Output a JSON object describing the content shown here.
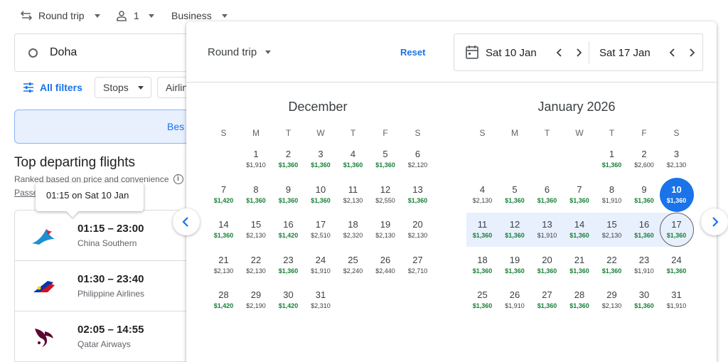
{
  "topbar": {
    "trip": "Round trip",
    "passengers": "1",
    "cabin": "Business"
  },
  "search": {
    "origin": "Doha"
  },
  "filters": {
    "all": "All filters",
    "stops": "Stops",
    "airlines": "Airlin"
  },
  "tabs": {
    "best": "Bes"
  },
  "results": {
    "heading": "Top departing flights",
    "subtitle": "Ranked based on price and convenience",
    "passenger_link": "Passe",
    "tooltip": "01:15 on Sat 10 Jan",
    "flights": [
      {
        "time": "01:15 – 23:00",
        "airline": "China Southern",
        "logo": "china-southern-logo"
      },
      {
        "time": "01:30 – 23:40",
        "airline": "Philippine Airlines",
        "logo": "philippine-airlines-logo"
      },
      {
        "time": "02:05 – 14:55",
        "airline": "Qatar Airways",
        "logo": "qatar-airways-logo"
      }
    ]
  },
  "picker": {
    "trip": "Round trip",
    "reset": "Reset",
    "depart": "Sat 10 Jan",
    "return": "Sat 17 Jan",
    "weekdays": [
      "S",
      "M",
      "T",
      "W",
      "T",
      "F",
      "S"
    ],
    "months": [
      {
        "title": "December",
        "offset": 1,
        "days": [
          {
            "d": "1",
            "p": "$1,910",
            "g": false
          },
          {
            "d": "2",
            "p": "$1,360",
            "g": true
          },
          {
            "d": "3",
            "p": "$1,360",
            "g": true
          },
          {
            "d": "4",
            "p": "$1,360",
            "g": true
          },
          {
            "d": "5",
            "p": "$1,360",
            "g": true
          },
          {
            "d": "6",
            "p": "$2,120",
            "g": false
          },
          {
            "d": "7",
            "p": "$1,420",
            "g": true
          },
          {
            "d": "8",
            "p": "$1,360",
            "g": true
          },
          {
            "d": "9",
            "p": "$1,360",
            "g": true
          },
          {
            "d": "10",
            "p": "$1,360",
            "g": true
          },
          {
            "d": "11",
            "p": "$2,130",
            "g": false
          },
          {
            "d": "12",
            "p": "$2,550",
            "g": false
          },
          {
            "d": "13",
            "p": "$1,360",
            "g": true
          },
          {
            "d": "14",
            "p": "$1,360",
            "g": true
          },
          {
            "d": "15",
            "p": "$2,130",
            "g": false
          },
          {
            "d": "16",
            "p": "$1,420",
            "g": true
          },
          {
            "d": "17",
            "p": "$2,510",
            "g": false
          },
          {
            "d": "18",
            "p": "$2,320",
            "g": false
          },
          {
            "d": "19",
            "p": "$2,130",
            "g": false
          },
          {
            "d": "20",
            "p": "$2,130",
            "g": false
          },
          {
            "d": "21",
            "p": "$2,130",
            "g": false
          },
          {
            "d": "22",
            "p": "$2,130",
            "g": false
          },
          {
            "d": "23",
            "p": "$1,360",
            "g": true
          },
          {
            "d": "24",
            "p": "$1,910",
            "g": false
          },
          {
            "d": "25",
            "p": "$2,240",
            "g": false
          },
          {
            "d": "26",
            "p": "$2,440",
            "g": false
          },
          {
            "d": "27",
            "p": "$2,710",
            "g": false
          },
          {
            "d": "28",
            "p": "$1,420",
            "g": true
          },
          {
            "d": "29",
            "p": "$2,190",
            "g": false
          },
          {
            "d": "30",
            "p": "$1,420",
            "g": true
          },
          {
            "d": "31",
            "p": "$2,310",
            "g": false
          }
        ]
      },
      {
        "title": "January 2026",
        "offset": 4,
        "days": [
          {
            "d": "1",
            "p": "$1,360",
            "g": true
          },
          {
            "d": "2",
            "p": "$2,600",
            "g": false
          },
          {
            "d": "3",
            "p": "$2,130",
            "g": false
          },
          {
            "d": "4",
            "p": "$2,130",
            "g": false
          },
          {
            "d": "5",
            "p": "$1,360",
            "g": true
          },
          {
            "d": "6",
            "p": "$1,360",
            "g": true
          },
          {
            "d": "7",
            "p": "$1,360",
            "g": true
          },
          {
            "d": "8",
            "p": "$1,910",
            "g": false
          },
          {
            "d": "9",
            "p": "$1,360",
            "g": true
          },
          {
            "d": "10",
            "p": "$1,360",
            "g": true
          },
          {
            "d": "11",
            "p": "$1,360",
            "g": true
          },
          {
            "d": "12",
            "p": "$1,360",
            "g": true
          },
          {
            "d": "13",
            "p": "$1,910",
            "g": false
          },
          {
            "d": "14",
            "p": "$1,360",
            "g": true
          },
          {
            "d": "15",
            "p": "$2,130",
            "g": false
          },
          {
            "d": "16",
            "p": "$1,360",
            "g": true
          },
          {
            "d": "17",
            "p": "$1,360",
            "g": true
          },
          {
            "d": "18",
            "p": "$1,360",
            "g": true
          },
          {
            "d": "19",
            "p": "$1,360",
            "g": true
          },
          {
            "d": "20",
            "p": "$1,360",
            "g": true
          },
          {
            "d": "21",
            "p": "$1,360",
            "g": true
          },
          {
            "d": "22",
            "p": "$1,360",
            "g": true
          },
          {
            "d": "23",
            "p": "$1,910",
            "g": false
          },
          {
            "d": "24",
            "p": "$1,360",
            "g": true
          },
          {
            "d": "25",
            "p": "$1,360",
            "g": true
          },
          {
            "d": "26",
            "p": "$1,910",
            "g": false
          },
          {
            "d": "27",
            "p": "$1,360",
            "g": true
          },
          {
            "d": "28",
            "p": "$1,360",
            "g": true
          },
          {
            "d": "29",
            "p": "$2,130",
            "g": false
          },
          {
            "d": "30",
            "p": "$1,360",
            "g": true
          },
          {
            "d": "31",
            "p": "$1,910",
            "g": false
          }
        ]
      }
    ]
  },
  "colors": {
    "accent": "#1a73e8",
    "low_price": "#188038",
    "range": "#e8f0fe"
  }
}
